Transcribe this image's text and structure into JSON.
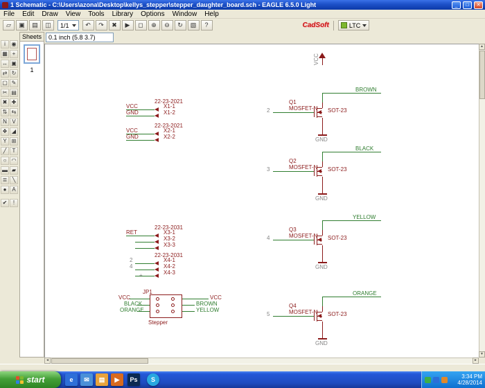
{
  "window": {
    "title": "1 Schematic - C:\\Users\\azona\\Desktop\\kellys_stepper\\stepper_daughter_board.sch - EAGLE 6.5.0 Light",
    "minimize": "_",
    "maximize": "□",
    "close": "✕"
  },
  "menu": {
    "items": [
      "File",
      "Edit",
      "Draw",
      "View",
      "Tools",
      "Library",
      "Options",
      "Window",
      "Help"
    ]
  },
  "toolbar": {
    "coord_display": "0.1 inch (5.8 3.7)",
    "sheet_combo": "1/1",
    "logo": "CadSoft",
    "ltc_label": "LTC",
    "buttons": [
      {
        "name": "open",
        "glyph": "▱"
      },
      {
        "name": "save",
        "glyph": "▣"
      },
      {
        "name": "print",
        "glyph": "▤"
      },
      {
        "name": "export-image",
        "glyph": "◫"
      },
      {
        "name": "undo",
        "glyph": "↶"
      },
      {
        "name": "redo",
        "glyph": "↷"
      },
      {
        "name": "stop",
        "glyph": "✖"
      },
      {
        "name": "go",
        "glyph": "▶"
      },
      {
        "name": "zoom-fit",
        "glyph": "◻"
      },
      {
        "name": "zoom-in",
        "glyph": "⊕"
      },
      {
        "name": "zoom-out",
        "glyph": "⊖"
      },
      {
        "name": "zoom-redraw",
        "glyph": "↻"
      },
      {
        "name": "zoom-select",
        "glyph": "▧"
      },
      {
        "name": "help",
        "glyph": "?"
      }
    ]
  },
  "sheets_panel": {
    "title": "Sheets",
    "sheet_number": "1"
  },
  "tool_palette": {
    "tools": [
      {
        "name": "info",
        "glyph": "i"
      },
      {
        "name": "show",
        "glyph": "◉"
      },
      {
        "name": "display",
        "glyph": "▦"
      },
      {
        "name": "mark",
        "glyph": "+"
      },
      {
        "name": "move",
        "glyph": "↔"
      },
      {
        "name": "copy",
        "glyph": "▣"
      },
      {
        "name": "mirror",
        "glyph": "⇄"
      },
      {
        "name": "rotate",
        "glyph": "↻"
      },
      {
        "name": "group",
        "glyph": "▢"
      },
      {
        "name": "change",
        "glyph": "✎"
      },
      {
        "name": "cut",
        "glyph": "✂"
      },
      {
        "name": "paste",
        "glyph": "▤"
      },
      {
        "name": "delete",
        "glyph": "✖"
      },
      {
        "name": "add",
        "glyph": "✚"
      },
      {
        "name": "pinswap",
        "glyph": "⇅"
      },
      {
        "name": "replace",
        "glyph": "⇆"
      },
      {
        "name": "name",
        "glyph": "N"
      },
      {
        "name": "value",
        "glyph": "V"
      },
      {
        "name": "smash",
        "glyph": "❖"
      },
      {
        "name": "miter",
        "glyph": "◢"
      },
      {
        "name": "split",
        "glyph": "Y"
      },
      {
        "name": "invoke",
        "glyph": "⊞"
      },
      {
        "name": "wire",
        "glyph": "╱"
      },
      {
        "name": "text",
        "glyph": "T"
      },
      {
        "name": "circle",
        "glyph": "○"
      },
      {
        "name": "arc",
        "glyph": "◠"
      },
      {
        "name": "rect",
        "glyph": "▬"
      },
      {
        "name": "polygon",
        "glyph": "▰"
      },
      {
        "name": "bus",
        "glyph": "≣"
      },
      {
        "name": "net",
        "glyph": "╲"
      },
      {
        "name": "junction",
        "glyph": "●"
      },
      {
        "name": "label",
        "glyph": "A"
      },
      {
        "name": "erc",
        "glyph": "✔"
      },
      {
        "name": "errors",
        "glyph": "!"
      }
    ]
  },
  "schematic": {
    "vcc_label": "VCC",
    "gnd_label": "GND",
    "origin_mark": "+",
    "transistors": [
      {
        "ref": "Q1",
        "value": "MOSFET-N",
        "package": "SOT-23",
        "net": "BROWN",
        "gate_net": "2"
      },
      {
        "ref": "Q2",
        "value": "MOSFET-N",
        "package": "SOT-23",
        "net": "BLACK",
        "gate_net": "3"
      },
      {
        "ref": "Q3",
        "value": "MOSFET-N",
        "package": "SOT-23",
        "net": "YELLOW",
        "gate_net": "4"
      },
      {
        "ref": "Q4",
        "value": "MOSFET-N",
        "package": "SOT-23",
        "net": "ORANGE",
        "gate_net": "5"
      }
    ],
    "connectors": [
      {
        "part": "22-23-2021",
        "pins": [
          "X1-1",
          "X1-2"
        ],
        "nets": [
          "VCC",
          "GND"
        ]
      },
      {
        "part": "22-23-2021",
        "pins": [
          "X2-1",
          "X2-2"
        ],
        "nets": [
          "VCC",
          "GND"
        ]
      },
      {
        "part": "22-23-2031",
        "pins": [
          "X3-1",
          "X3-2",
          "X3-3"
        ],
        "nets": [
          "RET"
        ]
      },
      {
        "part": "22-23-2031",
        "pins": [
          "X4-1",
          "X4-2",
          "X4-3"
        ],
        "nets": [
          "2",
          "4"
        ]
      }
    ],
    "stepper": {
      "ref": "JP1",
      "value": "Stepper",
      "left_nets": [
        "VCC",
        "BLACK",
        "ORANGE"
      ],
      "right_nets": [
        "VCC",
        "BROWN",
        "YELLOW"
      ]
    }
  },
  "scrollbar": {
    "up": "▲",
    "down": "▼",
    "left": "◄",
    "right": "►"
  },
  "taskbar": {
    "start_label": "start",
    "apps": [
      {
        "name": "internet-explorer",
        "glyph": "e"
      },
      {
        "name": "email",
        "glyph": "✉"
      },
      {
        "name": "explorer",
        "glyph": "▤"
      },
      {
        "name": "media-player",
        "glyph": "▶"
      },
      {
        "name": "photoshop",
        "glyph": "Ps"
      },
      {
        "name": "skype",
        "glyph": "S"
      }
    ],
    "tray_icons": [
      {
        "name": "antivirus"
      },
      {
        "name": "eagle"
      },
      {
        "name": "network"
      }
    ],
    "time": "3:34 PM",
    "date": "4/28/2014"
  },
  "colors": {
    "titlebar_blue": "#1c50c8",
    "taskbar_blue": "#2256d4",
    "start_green": "#3f9c34",
    "net_green": "#2f7d2f",
    "symbol_red": "#8b1a1a",
    "chrome": "#ece9d8",
    "canvas": "#ffffff"
  }
}
